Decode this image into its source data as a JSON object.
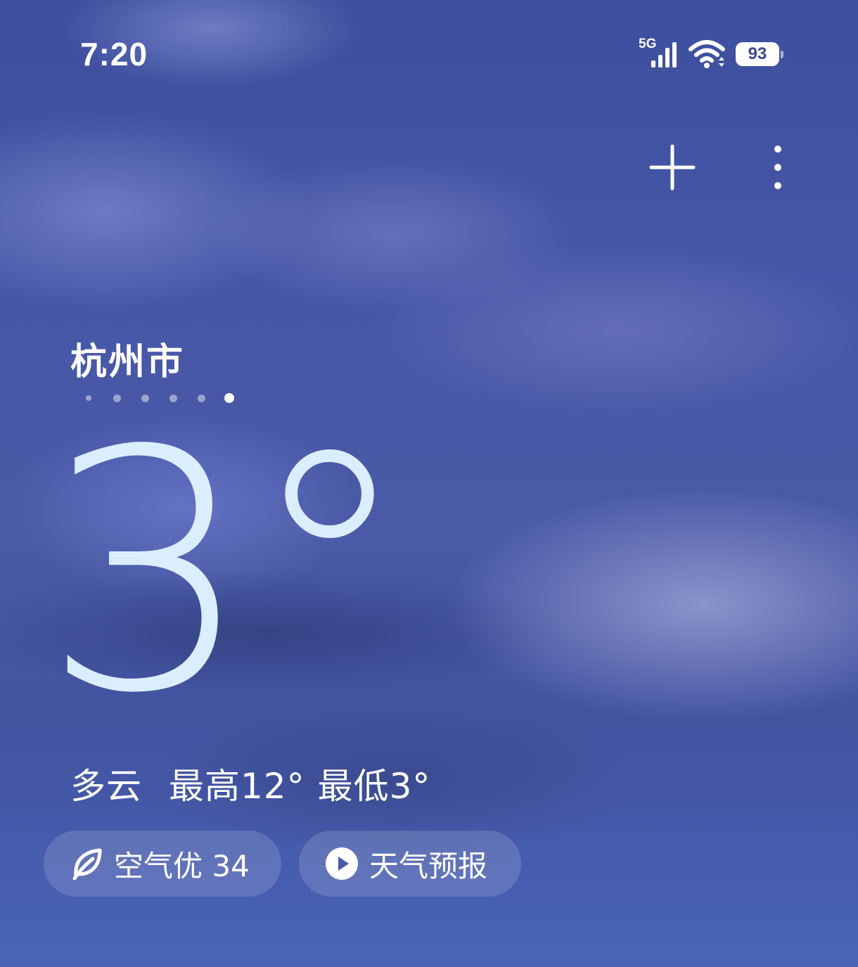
{
  "status_bar": {
    "time": "7:20",
    "network": "5G",
    "signal_icon": "signal-bars-icon",
    "wifi_icon": "wifi-icon",
    "battery_level": "93"
  },
  "toolbar": {
    "add_icon": "plus-icon",
    "more_icon": "more-vertical-icon"
  },
  "location": {
    "city": "杭州市",
    "page_count": 6,
    "active_page": 6
  },
  "weather": {
    "temperature": "3°",
    "condition": "多云",
    "high": "最高12°",
    "low": "最低3°"
  },
  "actions": {
    "air_quality": {
      "icon": "leaf-icon",
      "label": "空气优 34"
    },
    "forecast": {
      "icon": "play-circle-icon",
      "label": "天气预报"
    }
  },
  "colors": {
    "sky_top": "#3d4f9e",
    "sky_bottom": "#4a64b8",
    "temperature_text": "#dbeeff"
  }
}
